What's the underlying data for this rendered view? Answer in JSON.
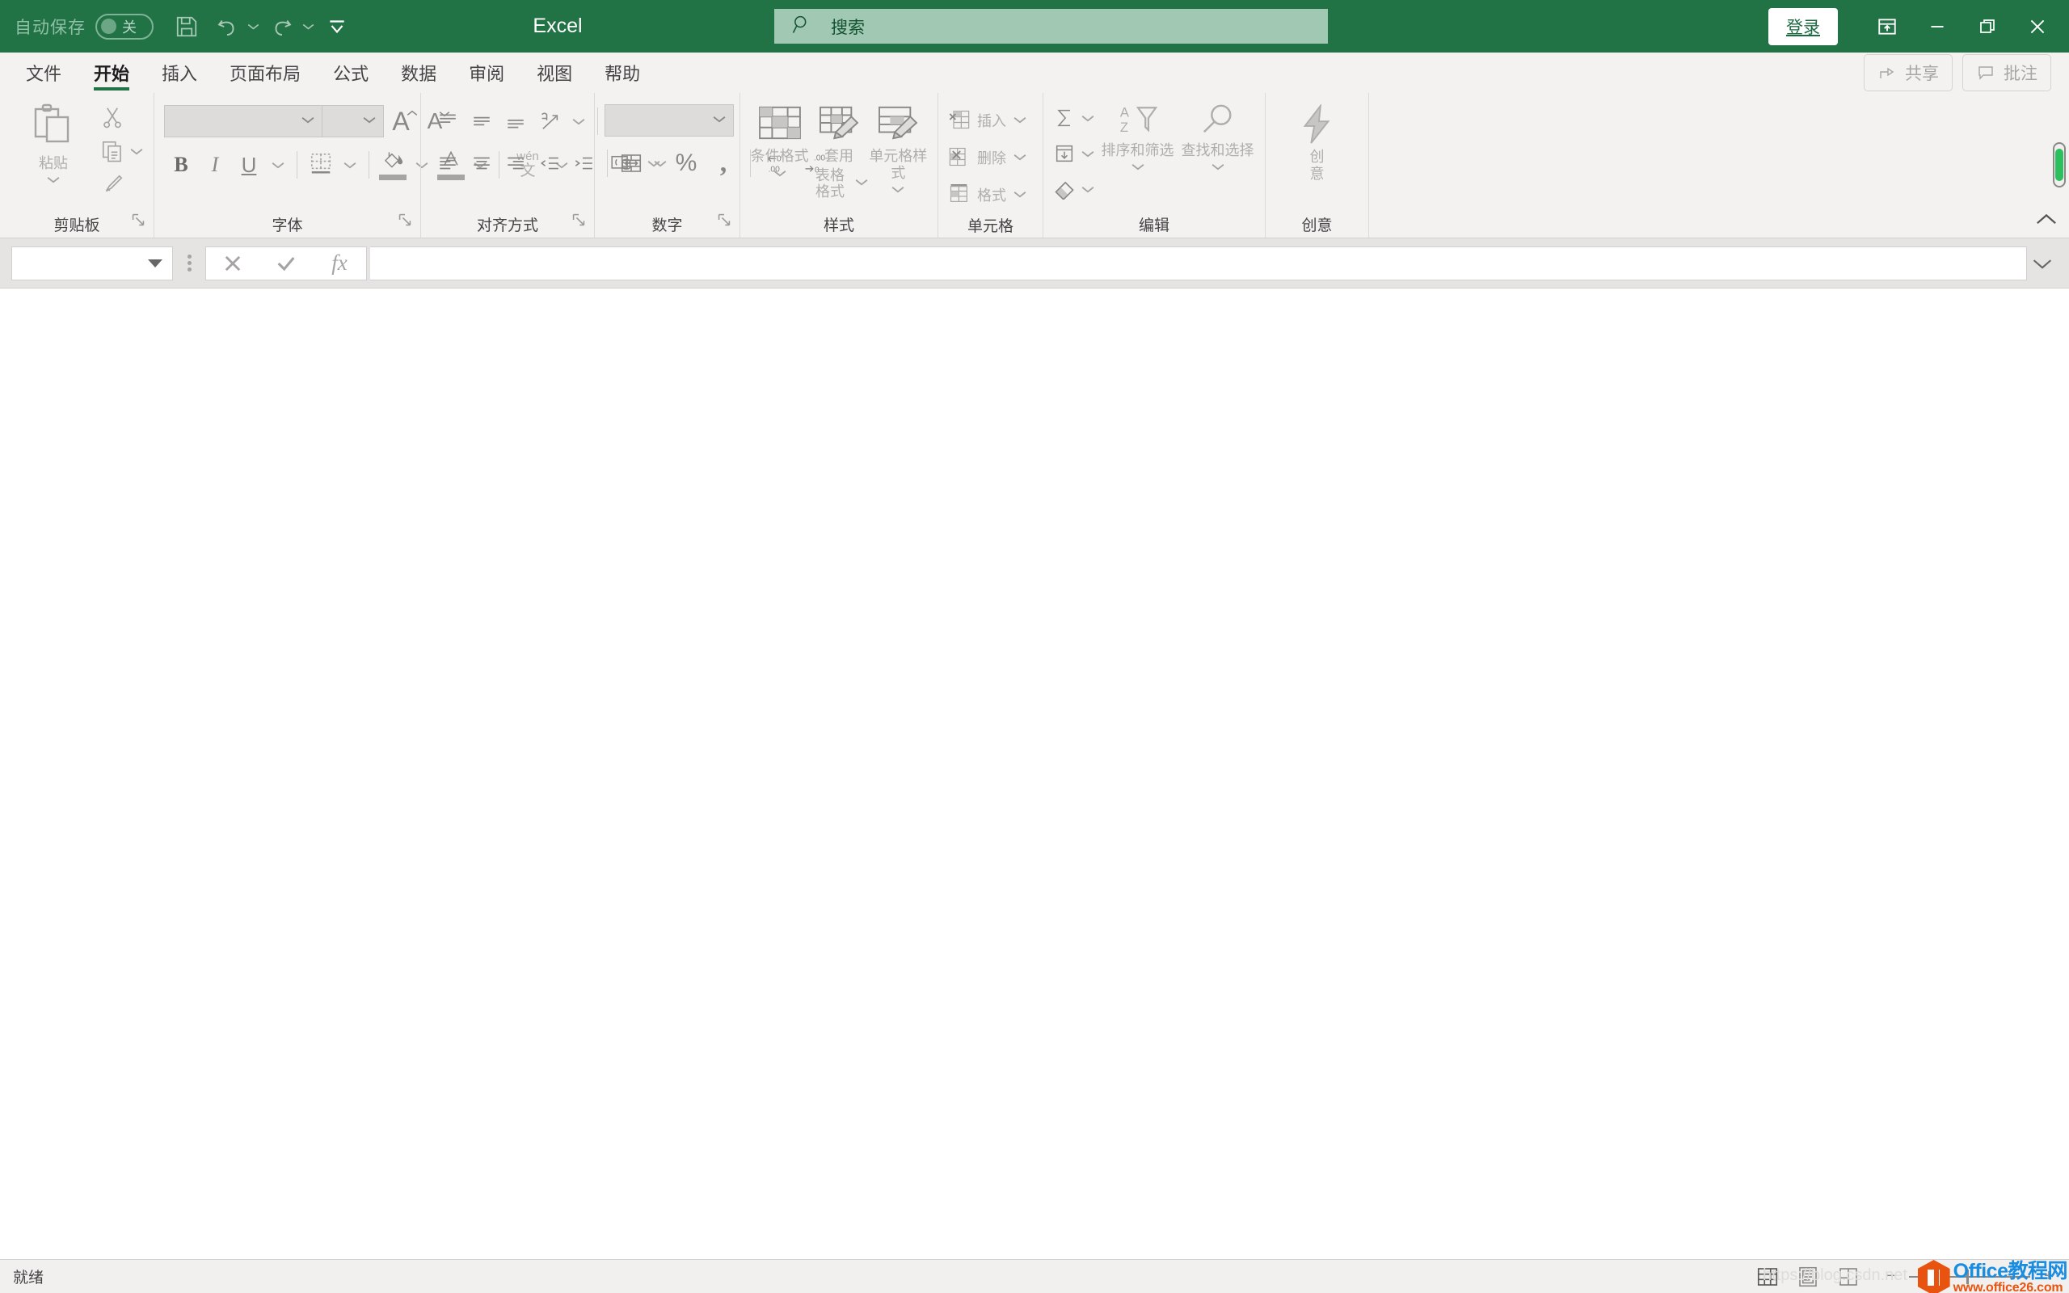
{
  "titlebar": {
    "autosave_label": "自动保存",
    "autosave_state": "关",
    "app_title": "Excel",
    "icons": {
      "save": "save-icon",
      "undo": "undo-icon",
      "redo": "redo-icon",
      "customize_qat": "customize-quick-access-toolbar-icon"
    },
    "search_placeholder": "搜索",
    "signin_label": "登录",
    "window": {
      "ribbon_display": "ribbon-display-options-icon",
      "minimize": "minimize-icon",
      "restore": "restore-icon",
      "close": "close-icon"
    },
    "colors": {
      "brand_green": "#217346",
      "search_bg": "#a0c8b2"
    }
  },
  "tabs": [
    {
      "label": "文件",
      "active": false
    },
    {
      "label": "开始",
      "active": true
    },
    {
      "label": "插入",
      "active": false
    },
    {
      "label": "页面布局",
      "active": false
    },
    {
      "label": "公式",
      "active": false
    },
    {
      "label": "数据",
      "active": false
    },
    {
      "label": "审阅",
      "active": false
    },
    {
      "label": "视图",
      "active": false
    },
    {
      "label": "帮助",
      "active": false
    }
  ],
  "tabstrip_right": [
    {
      "label": "共享",
      "icon": "share-icon"
    },
    {
      "label": "批注",
      "icon": "comment-icon"
    }
  ],
  "ribbon": {
    "clipboard": {
      "group_label": "剪贴板",
      "paste_label": "粘贴",
      "cut_label": "剪切",
      "copy_label": "复制",
      "format_painter_label": "格式刷"
    },
    "font": {
      "group_label": "字体",
      "font_name_value": "",
      "font_size_value": "",
      "grow_font": "A",
      "shrink_font": "A",
      "bold": "B",
      "italic": "I",
      "underline": "U",
      "phonetic_top": "wén",
      "phonetic_bottom": "文"
    },
    "alignment": {
      "group_label": "对齐方式"
    },
    "number": {
      "group_label": "数字",
      "format_value": ""
    },
    "styles": {
      "group_label": "样式",
      "conditional_formatting": "条件格式",
      "format_as_table_line1": "套用",
      "format_as_table_line2": "表格格式",
      "cell_styles": "单元格样式"
    },
    "cells": {
      "group_label": "单元格",
      "insert": "插入",
      "delete": "删除",
      "format": "格式"
    },
    "editing": {
      "group_label": "编辑",
      "sort_filter": "排序和筛选",
      "find_select": "查找和选择"
    },
    "ideas": {
      "group_label": "创意",
      "button_line1": "创",
      "button_line2": "意"
    }
  },
  "formulabar": {
    "name_box_value": "",
    "cancel_icon": "cancel-icon",
    "enter_icon": "enter-icon",
    "function_icon": "fx",
    "formula_value": ""
  },
  "statusbar": {
    "status_text": "就绪",
    "views": [
      {
        "name": "normal-view",
        "active": true
      },
      {
        "name": "page-layout-view",
        "active": false
      },
      {
        "name": "page-break-preview",
        "active": false
      }
    ],
    "zoom_out": "−",
    "zoom_in": "+"
  },
  "watermark": {
    "title": "Office教程网",
    "url": "www.office26.com",
    "ghost_text": "https://blog.csdn.net",
    "colors": {
      "hex": "#e8540f",
      "title": "#1a8de0",
      "url": "#e8540f"
    }
  }
}
